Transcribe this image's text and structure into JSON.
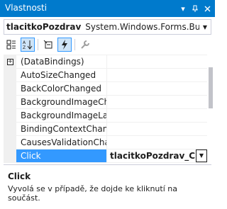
{
  "window": {
    "title": "Vlastnosti"
  },
  "object_selector": {
    "name": "tlacitkoPozdrav",
    "type": "System.Windows.Forms.Button"
  },
  "toolbar": {
    "buttons": [
      "categorized-icon",
      "alphabetical-icon",
      "properties-icon",
      "events-icon",
      "property-pages-icon"
    ],
    "active": [
      "alphabetical-icon",
      "events-icon"
    ]
  },
  "grid": {
    "rows": [
      {
        "name": "(DataBindings)",
        "value": ""
      },
      {
        "name": "AutoSizeChanged",
        "value": ""
      },
      {
        "name": "BackColorChanged",
        "value": ""
      },
      {
        "name": "BackgroundImageChanged",
        "value": ""
      },
      {
        "name": "BackgroundImageLayoutChanged",
        "value": ""
      },
      {
        "name": "BindingContextChanged",
        "value": ""
      },
      {
        "name": "CausesValidationChanged",
        "value": ""
      },
      {
        "name": "Click",
        "value": "tlacitkoPozdrav_Click"
      }
    ]
  },
  "description": {
    "title": "Click",
    "text": "Vyvolá se v případě, že dojde ke kliknutí na součást."
  },
  "colors": {
    "accent": "#007acc",
    "selection": "#3399ff",
    "gutter": "#f0f0f0"
  }
}
